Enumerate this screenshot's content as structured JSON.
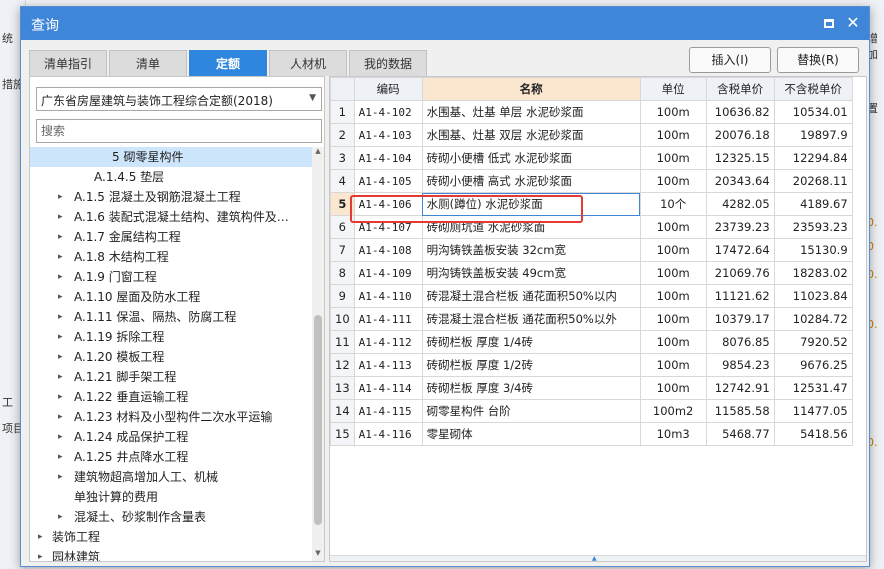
{
  "background": {
    "left_fragments": [
      "统",
      "措施",
      "工",
      "项目"
    ],
    "right_fragments": [
      "增加",
      "置",
      "0.",
      "0",
      "0.",
      "0.",
      "0."
    ]
  },
  "dialog": {
    "title": "查询",
    "tabs": [
      "清单指引",
      "清单",
      "定额",
      "人材机",
      "我的数据"
    ],
    "active_tab": "定额",
    "insert_button": "插入(I)",
    "replace_button": "替换(R)"
  },
  "left": {
    "combo_value": "广东省房屋建筑与装饰工程综合定额(2018)",
    "search_placeholder": "搜索",
    "tree": [
      {
        "label": "5 砌零星构件",
        "toggle": "",
        "selected": true
      },
      {
        "label": "A.1.4.5 垫层",
        "toggle": "",
        "selected": false
      },
      {
        "label": "A.1.5 混凝土及钢筋混凝土工程",
        "toggle": "▸",
        "selected": false
      },
      {
        "label": "A.1.6 装配式混凝土结构、建筑构件及…",
        "toggle": "▸",
        "selected": false
      },
      {
        "label": "A.1.7 金属结构工程",
        "toggle": "▸",
        "selected": false
      },
      {
        "label": "A.1.8 木结构工程",
        "toggle": "▸",
        "selected": false
      },
      {
        "label": "A.1.9 门窗工程",
        "toggle": "▸",
        "selected": false
      },
      {
        "label": "A.1.10 屋面及防水工程",
        "toggle": "▸",
        "selected": false
      },
      {
        "label": "A.1.11 保温、隔热、防腐工程",
        "toggle": "▸",
        "selected": false
      },
      {
        "label": "A.1.19 拆除工程",
        "toggle": "▸",
        "selected": false
      },
      {
        "label": "A.1.20 模板工程",
        "toggle": "▸",
        "selected": false
      },
      {
        "label": "A.1.21 脚手架工程",
        "toggle": "▸",
        "selected": false
      },
      {
        "label": "A.1.22 垂直运输工程",
        "toggle": "▸",
        "selected": false
      },
      {
        "label": "A.1.23 材料及小型构件二次水平运输",
        "toggle": "▸",
        "selected": false
      },
      {
        "label": "A.1.24 成品保护工程",
        "toggle": "▸",
        "selected": false
      },
      {
        "label": "A.1.25 井点降水工程",
        "toggle": "▸",
        "selected": false
      },
      {
        "label": "建筑物超高增加人工、机械",
        "toggle": "▸",
        "selected": false
      },
      {
        "label": "单独计算的费用",
        "toggle": "",
        "selected": false
      },
      {
        "label": "混凝土、砂浆制作含量表",
        "toggle": "▸",
        "selected": false
      },
      {
        "label": "装饰工程",
        "toggle": "▸",
        "selected": false
      },
      {
        "label": "园林建筑",
        "toggle": "▸",
        "selected": false
      }
    ]
  },
  "grid": {
    "headers": [
      "",
      "编码",
      "名称",
      "单位",
      "含税单价",
      "不含税单价"
    ],
    "rows": [
      {
        "idx": "1",
        "code": "A1-4-102",
        "name": "水围基、灶基 单层 水泥砂浆面",
        "unit": "100m",
        "price_tax": "10636.82",
        "price_notax": "10534.01"
      },
      {
        "idx": "2",
        "code": "A1-4-103",
        "name": "水围基、灶基 双层 水泥砂浆面",
        "unit": "100m",
        "price_tax": "20076.18",
        "price_notax": "19897.9"
      },
      {
        "idx": "3",
        "code": "A1-4-104",
        "name": "砖砌小便槽 低式 水泥砂浆面",
        "unit": "100m",
        "price_tax": "12325.15",
        "price_notax": "12294.84"
      },
      {
        "idx": "4",
        "code": "A1-4-105",
        "name": "砖砌小便槽 高式 水泥砂浆面",
        "unit": "100m",
        "price_tax": "20343.64",
        "price_notax": "20268.11"
      },
      {
        "idx": "5",
        "code": "A1-4-106",
        "name": "水厕(蹲位) 水泥砂浆面",
        "unit": "10个",
        "price_tax": "4282.05",
        "price_notax": "4189.67"
      },
      {
        "idx": "6",
        "code": "A1-4-107",
        "name": "砖砌厕坑道 水泥砂浆面",
        "unit": "100m",
        "price_tax": "23739.23",
        "price_notax": "23593.23"
      },
      {
        "idx": "7",
        "code": "A1-4-108",
        "name": "明沟铸铁盖板安装 32cm宽",
        "unit": "100m",
        "price_tax": "17472.64",
        "price_notax": "15130.9"
      },
      {
        "idx": "8",
        "code": "A1-4-109",
        "name": "明沟铸铁盖板安装 49cm宽",
        "unit": "100m",
        "price_tax": "21069.76",
        "price_notax": "18283.02"
      },
      {
        "idx": "9",
        "code": "A1-4-110",
        "name": "砖混凝土混合栏板 通花面积50%以内",
        "unit": "100m",
        "price_tax": "11121.62",
        "price_notax": "11023.84"
      },
      {
        "idx": "10",
        "code": "A1-4-111",
        "name": "砖混凝土混合栏板 通花面积50%以外",
        "unit": "100m",
        "price_tax": "10379.17",
        "price_notax": "10284.72"
      },
      {
        "idx": "11",
        "code": "A1-4-112",
        "name": "砖砌栏板 厚度 1/4砖",
        "unit": "100m",
        "price_tax": "8076.85",
        "price_notax": "7920.52"
      },
      {
        "idx": "12",
        "code": "A1-4-113",
        "name": "砖砌栏板 厚度 1/2砖",
        "unit": "100m",
        "price_tax": "9854.23",
        "price_notax": "9676.25"
      },
      {
        "idx": "13",
        "code": "A1-4-114",
        "name": "砖砌栏板 厚度 3/4砖",
        "unit": "100m",
        "price_tax": "12742.91",
        "price_notax": "12531.47"
      },
      {
        "idx": "14",
        "code": "A1-4-115",
        "name": "砌零星构件 台阶",
        "unit": "100m2",
        "price_tax": "11585.58",
        "price_notax": "11477.05"
      },
      {
        "idx": "15",
        "code": "A1-4-116",
        "name": "零星砌体",
        "unit": "10m3",
        "price_tax": "5468.77",
        "price_notax": "5418.56"
      }
    ],
    "selected_row": "5"
  }
}
